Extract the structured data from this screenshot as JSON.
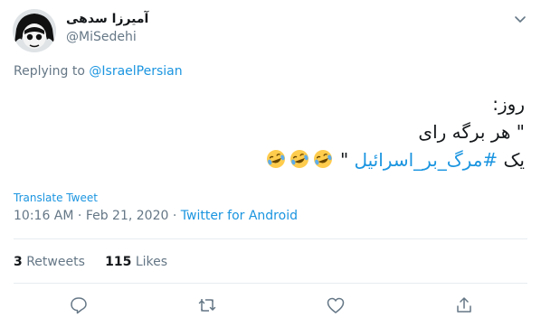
{
  "author": {
    "display_name": "آمیرزا سدهی",
    "handle": "@MiSedehi"
  },
  "reply": {
    "prefix": "Replying to",
    "to": "@IsraelPersian"
  },
  "tweet": {
    "line1": "روز:",
    "line2": "\" هر برگه رای",
    "line3_prefix": "یک",
    "hashtag": "#مرگ_بر_اسرائیل",
    "line3_suffix": "\""
  },
  "translate_label": "Translate Tweet",
  "meta": {
    "time": "10:16 AM",
    "date": "Feb 21, 2020",
    "separator": "·",
    "source": "Twitter for Android"
  },
  "stats": {
    "retweets_count": "3",
    "retweets_label": "Retweets",
    "likes_count": "115",
    "likes_label": "Likes"
  },
  "icons": {
    "reply": "reply-icon",
    "retweet": "retweet-icon",
    "like": "heart-icon",
    "share": "share-icon",
    "emoji": "rolling-on-floor-laughing-emoji"
  },
  "colors": {
    "link": "#1b95e0",
    "muted": "#657786",
    "text": "#14171a",
    "divider": "#e6ecf0"
  }
}
